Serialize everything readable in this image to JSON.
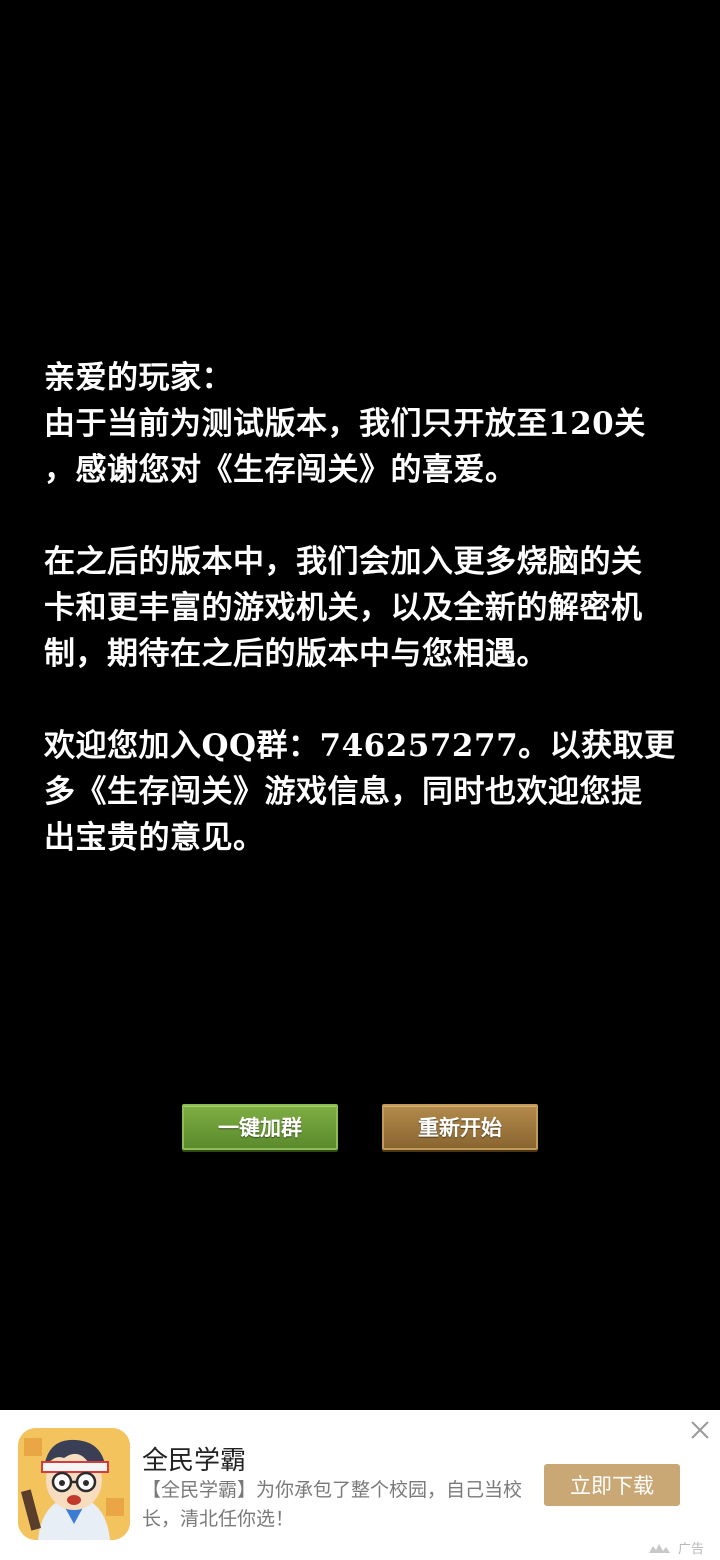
{
  "message": {
    "p1": [
      "亲爱的玩家：",
      "由于当前为测试版本，我们只开放至120关",
      "，感谢您对《生存闯关》的喜爱。"
    ],
    "p2": [
      "在之后的版本中，我们会加入更多烧脑的关",
      "卡和更丰富的游戏机关，以及全新的解密机",
      "制，期待在之后的版本中与您相遇。"
    ],
    "p3": [
      "欢迎您加入QQ群：746257277。以获取更",
      "多《生存闯关》游戏信息，同时也欢迎您提",
      "出宝贵的意见。"
    ]
  },
  "buttons": {
    "join_group": "一键加群",
    "restart": "重新开始"
  },
  "ad": {
    "app_name": "全民学霸",
    "description": "【全民学霸】为你承包了整个校园，自己当校长，清北任你选！",
    "download_label": "立即下载",
    "badge_label": "广告",
    "close_icon": "close-icon",
    "colors": {
      "download_bg": "#c9a876",
      "join_button": "#6a9c36",
      "restart_button": "#9e7640"
    }
  }
}
